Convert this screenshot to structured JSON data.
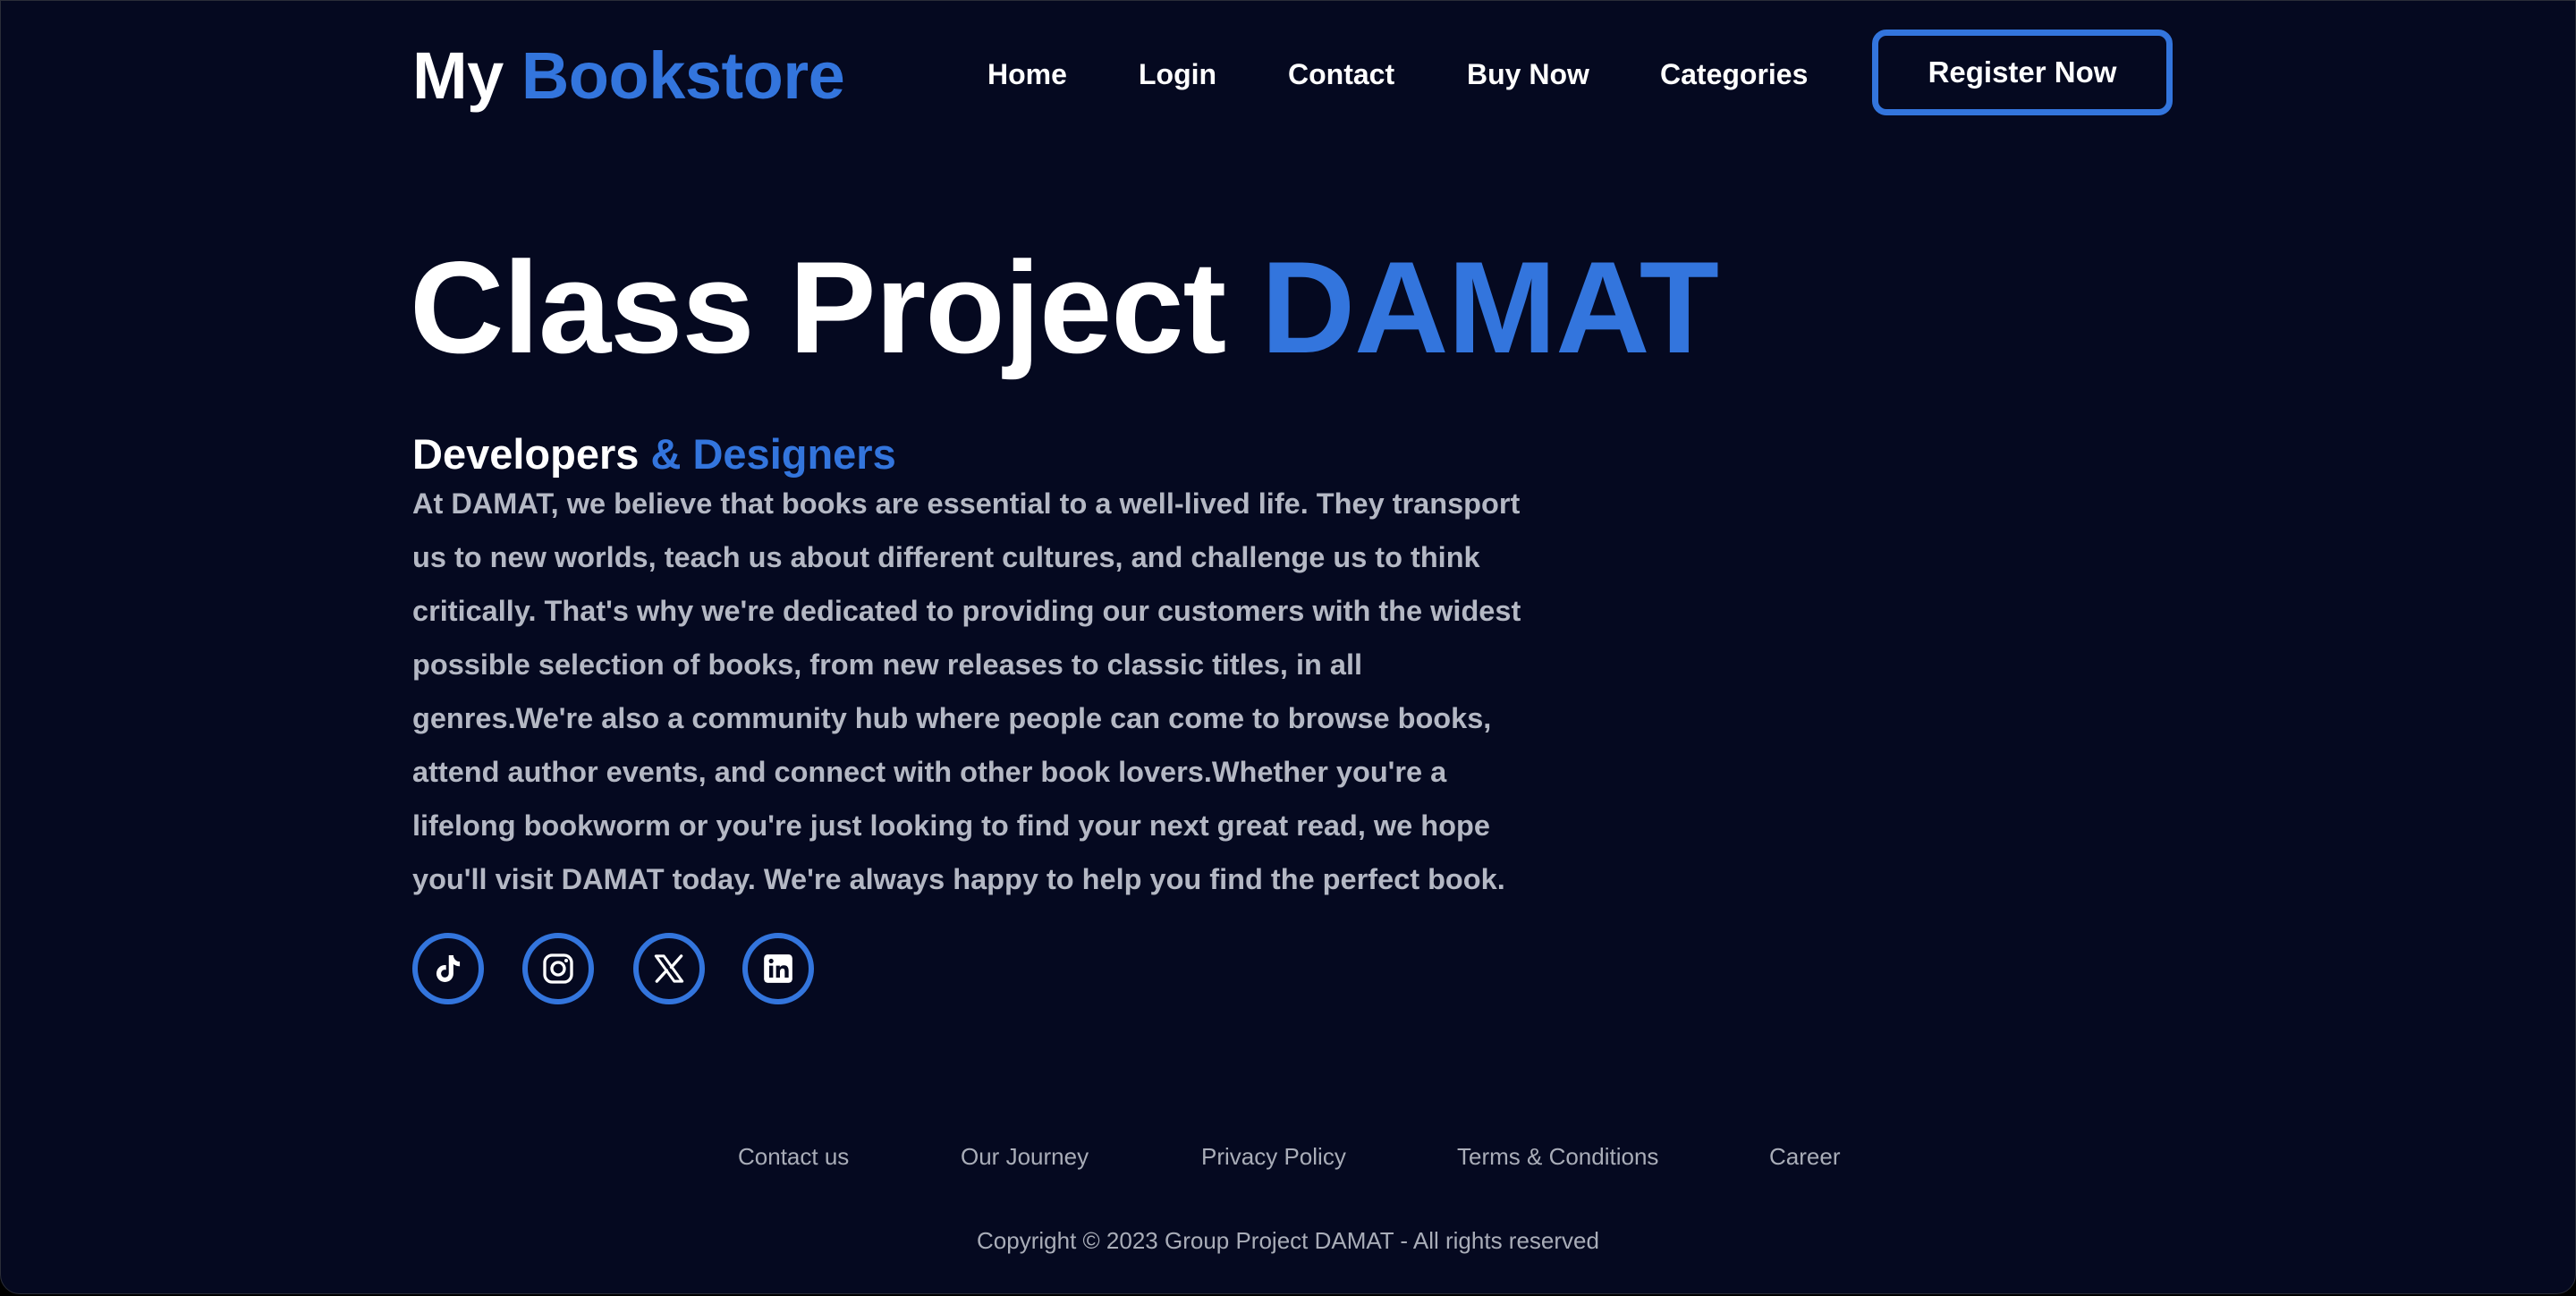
{
  "header": {
    "logo": {
      "part1": "My ",
      "part2": "Bookstore"
    },
    "nav": [
      {
        "label": "Home"
      },
      {
        "label": "Login"
      },
      {
        "label": "Contact"
      },
      {
        "label": "Buy Now"
      },
      {
        "label": "Categories"
      }
    ],
    "register_label": "Register Now"
  },
  "hero": {
    "title_part1": "Class Project ",
    "title_part2": "DAMAT",
    "subtitle_part1": "Developers ",
    "subtitle_part2": "& Designers",
    "body": "At DAMAT, we believe that books are essential to a well-lived life. They transport us to new worlds, teach us about different cultures, and challenge us to think critically. That's why we're dedicated to providing our customers with the widest possible selection of books, from new releases to classic titles, in all genres.We're also a community hub where people can come to browse books, attend author events, and connect with other book lovers.Whether you're a lifelong bookworm or you're just looking to find your next great read, we hope you'll visit DAMAT today. We're always happy to help you find the perfect book."
  },
  "social": [
    {
      "icon": "tiktok-icon"
    },
    {
      "icon": "instagram-icon"
    },
    {
      "icon": "x-icon"
    },
    {
      "icon": "linkedin-icon"
    }
  ],
  "footer": {
    "links": [
      {
        "label": "Contact us"
      },
      {
        "label": "Our Journey"
      },
      {
        "label": "Privacy Policy"
      },
      {
        "label": "Terms & Conditions"
      },
      {
        "label": "Career"
      }
    ],
    "copyright": "Copyright © 2023 Group Project DAMAT - All rights reserved"
  },
  "colors": {
    "background": "#050920",
    "accent": "#3375dd",
    "heading": "#ffffff",
    "body_text": "#b4b8c4",
    "footer_text": "#a9adb8"
  }
}
